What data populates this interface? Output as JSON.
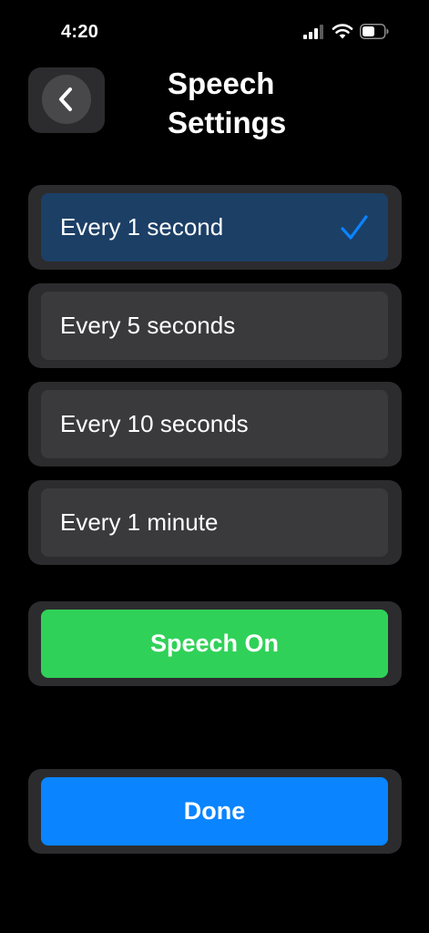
{
  "status_bar": {
    "time": "4:20"
  },
  "header": {
    "back_icon": "chevron-left-icon",
    "title": "Speech\nSettings"
  },
  "options": [
    {
      "label": "Every 1 second",
      "selected": true
    },
    {
      "label": "Every 5 seconds",
      "selected": false
    },
    {
      "label": "Every 10 seconds",
      "selected": false
    },
    {
      "label": "Every 1 minute",
      "selected": false
    }
  ],
  "speech_toggle": {
    "label": "Speech On",
    "color": "#30d158"
  },
  "done": {
    "label": "Done",
    "color": "#0a84ff"
  },
  "colors": {
    "selected_option": "#1c3f66",
    "check_mark": "#0a84ff",
    "card": "#2c2c2e",
    "option": "#3a3a3c"
  }
}
